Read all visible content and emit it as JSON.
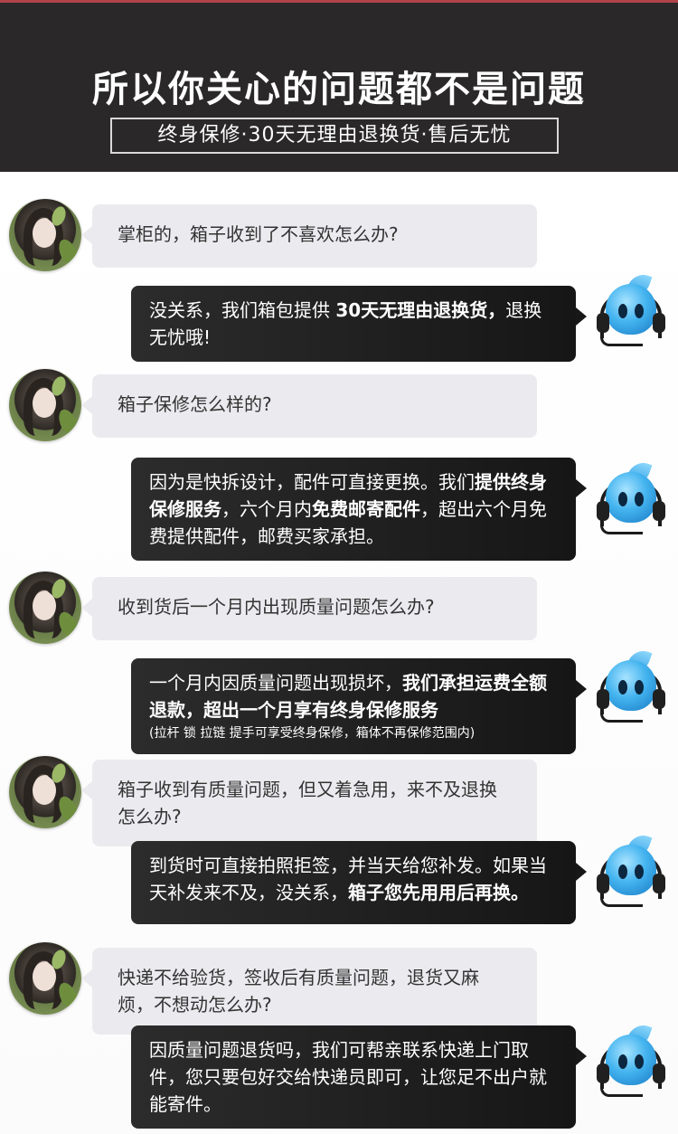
{
  "header": {
    "title": "所以你关心的问题都不是问题",
    "subtitle": "终身保修·30天无理由退换货·售后无忧",
    "accent_color": "#b2424a",
    "background_color": "#2a2829"
  },
  "chat": [
    {
      "question": "掌柜的，箱子收到了不喜欢怎么办?",
      "answer": [
        {
          "text": "没关系，我们箱包提供 ",
          "bold": false
        },
        {
          "text": "30天无理由退换货，",
          "bold": true
        },
        {
          "text": "退换无忧哦!",
          "bold": false
        }
      ]
    },
    {
      "question": "箱子保修怎么样的?",
      "answer": [
        {
          "text": "因为是快拆设计，配件可直接更换。我们",
          "bold": false
        },
        {
          "text": "提供终身保修服务",
          "bold": true
        },
        {
          "text": "，六个月内",
          "bold": false
        },
        {
          "text": "免费邮寄配件",
          "bold": true
        },
        {
          "text": "，超出六个月免费提供配件，邮费买家承担。",
          "bold": false
        }
      ]
    },
    {
      "question": "收到货后一个月内出现质量问题怎么办?",
      "answer": [
        {
          "text": "一个月内因质量问题出现损坏，",
          "bold": false
        },
        {
          "text": "我们承担运费全额退款，超出一个月享有终身保修服务",
          "bold": true
        }
      ],
      "note": "(拉杆 锁 拉链 提手可享受终身保修，箱体不再保修范围内)"
    },
    {
      "question": "箱子收到有质量问题，但又着急用，来不及退换怎么办?",
      "answer": [
        {
          "text": "到货时可直接拍照拒签，并当天给您补发。如果当天补发来不及，没关系，",
          "bold": false
        },
        {
          "text": "箱子您先用用后再换。",
          "bold": true
        }
      ]
    },
    {
      "question": "快递不给验货，签收后有质量问题，退货又麻烦，不想动怎么办?",
      "answer": [
        {
          "text": "因质量问题退货吗，我们可帮亲联系快递上门取件，您只要包好交给快递员即可，让您足不出户就能寄件。",
          "bold": false
        }
      ]
    }
  ],
  "icons": {
    "customer_avatar": "customer-avatar",
    "service_avatar": "customer-service-bot-icon"
  }
}
